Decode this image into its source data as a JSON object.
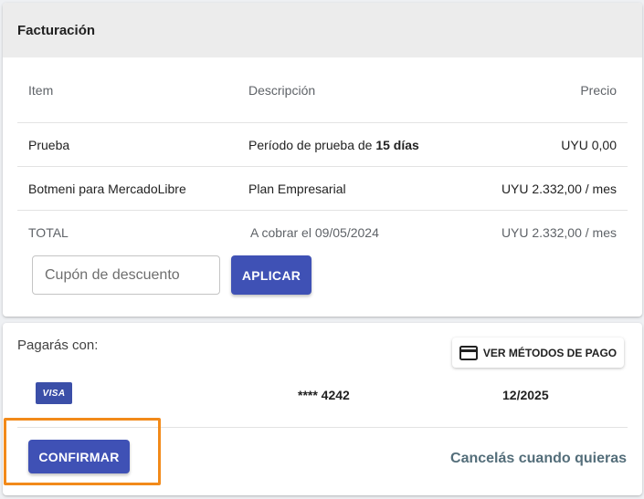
{
  "billing": {
    "title": "Facturación",
    "columns": {
      "item": "Item",
      "description": "Descripción",
      "price": "Precio"
    },
    "rows": [
      {
        "item": "Prueba",
        "description_prefix": "Período de prueba de ",
        "description_bold": "15 días",
        "price": "UYU 0,00"
      },
      {
        "item": "Botmeni para MercadoLibre",
        "description": "Plan Empresarial",
        "price": "UYU 2.332,00 / mes"
      }
    ],
    "total": {
      "label": "TOTAL",
      "description": "A cobrar el 09/05/2024",
      "price": "UYU 2.332,00 / mes"
    },
    "coupon": {
      "placeholder": "Cupón de descuento",
      "value": ""
    },
    "apply_label": "APLICAR"
  },
  "payment": {
    "title": "Pagarás con:",
    "view_methods_label": "VER MÉTODOS DE PAGO",
    "card": {
      "brand": "VISA",
      "number": "**** 4242",
      "expiry": "12/2025"
    },
    "confirm_label": "CONFIRMAR",
    "cancel_text": "Cancelás cuando quieras"
  },
  "colors": {
    "primary": "#3f51b5",
    "header_bg": "#ececec",
    "highlight": "#f28a1a",
    "visa": "#3b4fa8",
    "cancel_text": "#546e7a"
  },
  "icons": {
    "payment_methods": "credit-card-icon"
  }
}
